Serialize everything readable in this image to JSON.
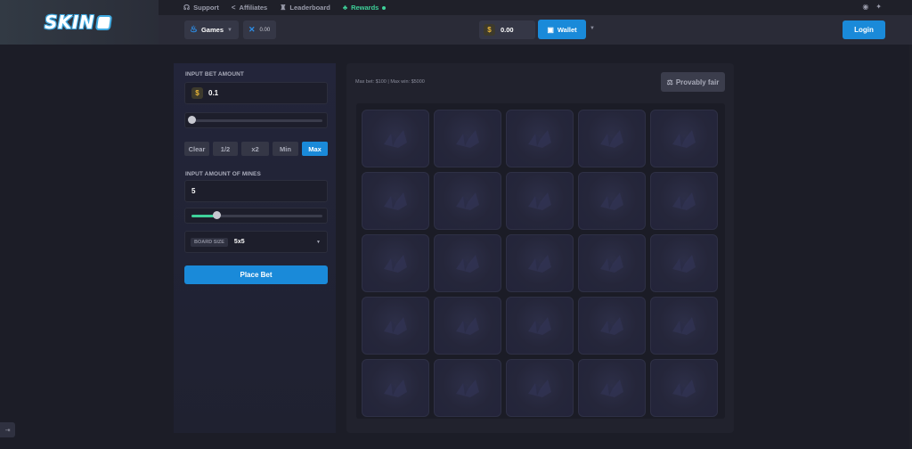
{
  "logo": {
    "text": "SKIN"
  },
  "topnav": [
    {
      "label": "Support",
      "icon": "headset-icon"
    },
    {
      "label": "Affiliates",
      "icon": "share-icon"
    },
    {
      "label": "Leaderboard",
      "icon": "trophy-icon"
    },
    {
      "label": "Rewards",
      "icon": "gift-icon",
      "color": "#3ed19a"
    }
  ],
  "navbar": {
    "games_label": "Games",
    "x_balance": "0.00",
    "balance": "0.00",
    "wallet_label": "Wallet",
    "login_label": "Login"
  },
  "bet": {
    "amount_label": "INPUT BET AMOUNT",
    "amount_value": "0.1",
    "amount_slider_fraction": 0.0,
    "quick_buttons": [
      "Clear",
      "1/2",
      "x2",
      "Min",
      "Max"
    ],
    "active_quick_button": "Max",
    "mines_label": "INPUT AMOUNT OF MINES",
    "mines_value": "5",
    "mines_slider_fraction": 0.19,
    "board_size_tag": "BOARD SIZE",
    "board_size_value": "5x5",
    "place_bet_label": "Place Bet"
  },
  "game": {
    "limits_text": "Max bet: $100 | Max win: $5000",
    "provably_fair_label": "Provably fair",
    "rows": 5,
    "cols": 5
  },
  "colors": {
    "accent": "#1a8ad9",
    "green": "#3ed19a",
    "bg": "#1c1d27"
  }
}
